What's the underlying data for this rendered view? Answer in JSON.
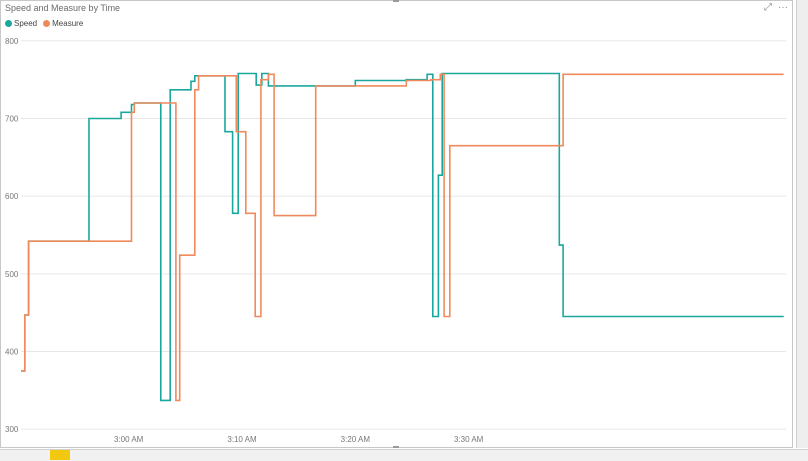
{
  "chart_data": {
    "type": "line",
    "title": "Speed and Measure by Time",
    "xlabel": "",
    "ylabel": "",
    "ylim": [
      295,
      805
    ],
    "xlim_minutes": [
      170.5,
      238
    ],
    "yticks": [
      "300",
      "400",
      "500",
      "600",
      "700",
      "800"
    ],
    "xticks": [
      "3:00 AM",
      "3:10 AM",
      "3:20 AM",
      "3:30 AM"
    ],
    "legend_position": "top-left",
    "grid": true,
    "series": [
      {
        "name": "Speed",
        "color": "#1aa89e",
        "x": [
          "2:50:30",
          "2:50:50",
          "2:51:10",
          "2:56:30",
          "2:59:20",
          "3:00:15",
          "3:00:30",
          "3:02:50",
          "3:03:40",
          "3:05:30",
          "3:05:50",
          "3:08:10",
          "3:08:30",
          "3:09:10",
          "3:09:40",
          "3:10:10",
          "3:11:15",
          "3:11:45",
          "3:12:20",
          "3:12:40",
          "3:16:30",
          "3:20:00",
          "3:24:30",
          "3:26:20",
          "3:26:50",
          "3:27:20",
          "3:27:40",
          "3:28:20",
          "3:38:00",
          "3:38:20"
        ],
        "y": [
          375,
          447,
          542,
          700,
          708,
          718,
          720,
          337,
          737,
          748,
          755,
          755,
          683,
          578,
          758,
          758,
          743,
          758,
          742,
          742,
          742,
          749,
          750,
          757,
          445,
          627,
          758,
          758,
          537,
          445
        ]
      },
      {
        "name": "Measure",
        "color": "#f08a5d",
        "x": [
          "2:50:30",
          "2:50:50",
          "2:51:10",
          "2:59:20",
          "3:00:15",
          "3:00:30",
          "3:03:40",
          "3:04:10",
          "3:04:30",
          "3:05:50",
          "3:06:10",
          "3:08:30",
          "3:09:30",
          "3:10:20",
          "3:11:10",
          "3:11:40",
          "3:12:20",
          "3:12:50",
          "3:16:30",
          "3:20:00",
          "3:24:30",
          "3:26:40",
          "3:27:30",
          "3:27:50",
          "3:28:20",
          "3:38:20"
        ],
        "y": [
          375,
          447,
          542,
          542,
          708,
          720,
          720,
          337,
          524,
          737,
          755,
          755,
          683,
          578,
          445,
          750,
          757,
          575,
          742,
          742,
          749,
          750,
          757,
          445,
          665,
          757
        ]
      }
    ]
  },
  "ui": {
    "focus_icon": "focus-mode-icon",
    "more_icon": "more-options-icon",
    "more_label": "···"
  }
}
